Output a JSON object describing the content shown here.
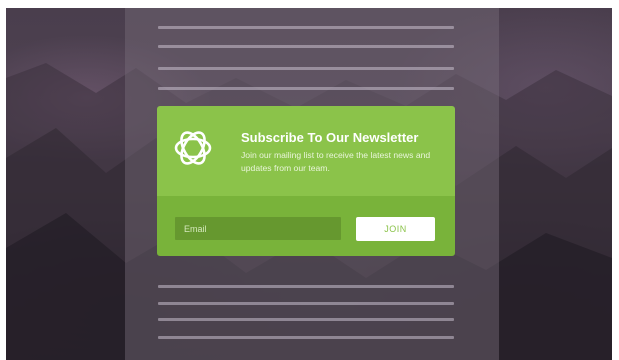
{
  "newsletter": {
    "title": "Subscribe To Our Newsletter",
    "description": "Join our mailing list to receive the latest news and updates from our team.",
    "email_placeholder": "Email",
    "email_value": "",
    "join_label": "JOIN",
    "logo_icon": "flower-logo-icon"
  },
  "colors": {
    "card_green": "#8bc34a",
    "card_green_dark": "#79b33a",
    "input_green": "#66982f",
    "button_bg": "#ffffff",
    "button_text": "#8bc34a"
  }
}
